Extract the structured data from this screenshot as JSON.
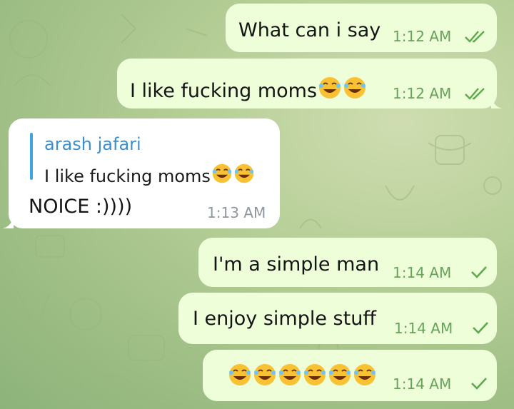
{
  "messages": [
    {
      "text": "What can i say",
      "time": "1:12 AM",
      "status": "double-check"
    },
    {
      "text": "I like fucking moms",
      "emoji": "rolling-on-floor-laughing x2",
      "time": "1:12 AM",
      "status": "double-check"
    },
    {
      "reply_to": {
        "author": "arash jafari",
        "text": "I like fucking moms",
        "emoji": "rolling-on-floor-laughing x2"
      },
      "text": "NOICE :))))",
      "time": "1:13 AM"
    },
    {
      "text": "I'm a simple man",
      "time": "1:14 AM",
      "status": "single-check"
    },
    {
      "text": "I enjoy simple stuff",
      "time": "1:14 AM",
      "status": "single-check"
    },
    {
      "emoji": "rolling-on-floor-laughing x6",
      "time": "1:14 AM",
      "status": "single-check"
    }
  ],
  "colors": {
    "outgoing_bubble": "#eefed9",
    "incoming_bubble": "#ffffff",
    "check": "#5ea94d",
    "quote_accent": "#3ea5e0",
    "quote_name": "#3a8fd0"
  }
}
